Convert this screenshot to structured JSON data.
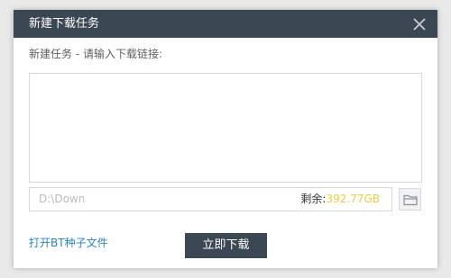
{
  "dialog": {
    "title": "新建下载任务",
    "subtitle": "新建任务 - 请输入下载链接:",
    "url_input": {
      "value": "",
      "placeholder": ""
    },
    "save_path": {
      "value": "D:\\Down"
    },
    "free_space": {
      "label": "剩余:",
      "value": "392.77GB"
    },
    "open_bt_link": "打开BT种子文件",
    "download_button": "立即下载"
  },
  "colors": {
    "titlebar": "#3b4752",
    "free_space_value": "#f5c842",
    "link": "#2b84c7"
  },
  "icons": {
    "close": "close-icon",
    "browse_folder": "folder-icon"
  }
}
